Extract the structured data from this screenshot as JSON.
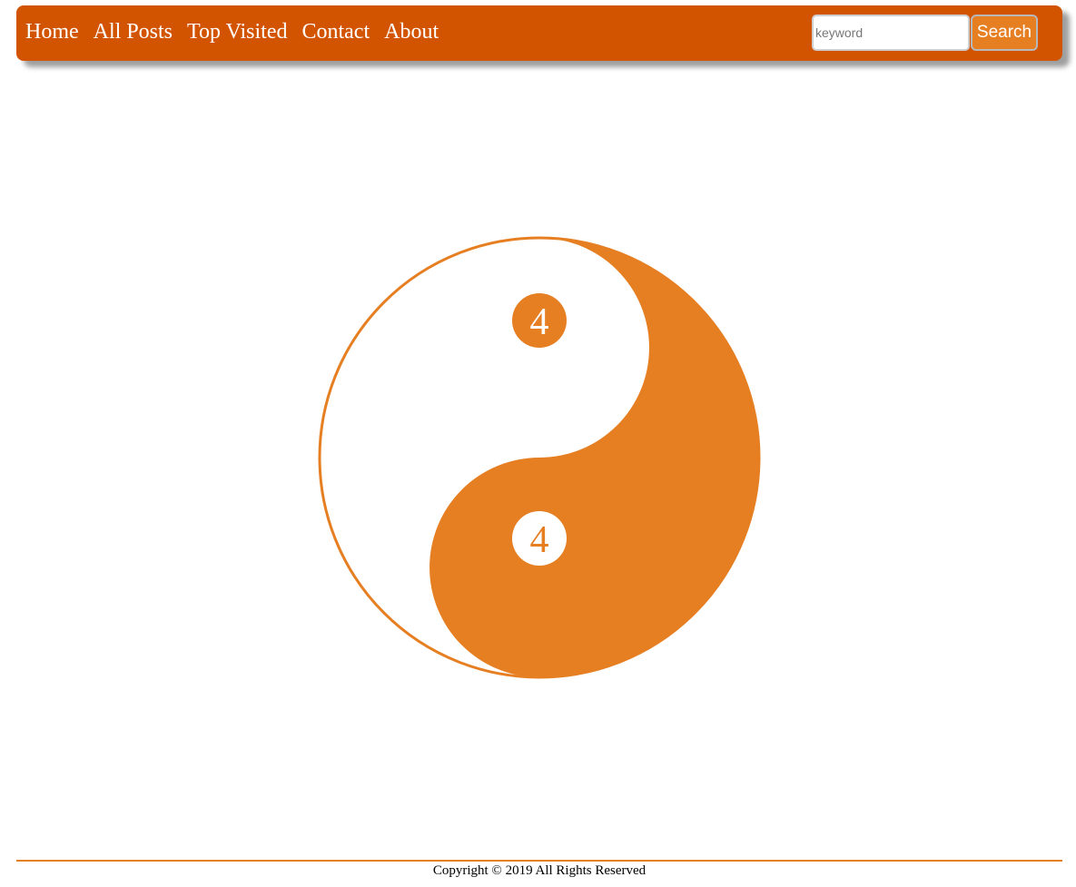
{
  "nav": {
    "links": [
      "Home",
      "All Posts",
      "Top Visited",
      "Contact",
      "About"
    ]
  },
  "search": {
    "placeholder": "keyword",
    "value": "",
    "button_label": "Search"
  },
  "yinyang": {
    "top_value": "4",
    "bottom_value": "4"
  },
  "footer": {
    "copyright": "Copyright © 2019 All Rights Reserved"
  },
  "colors": {
    "navbar_bg": "#d35400",
    "accent": "#e67e22",
    "text_light": "#ffffff"
  }
}
